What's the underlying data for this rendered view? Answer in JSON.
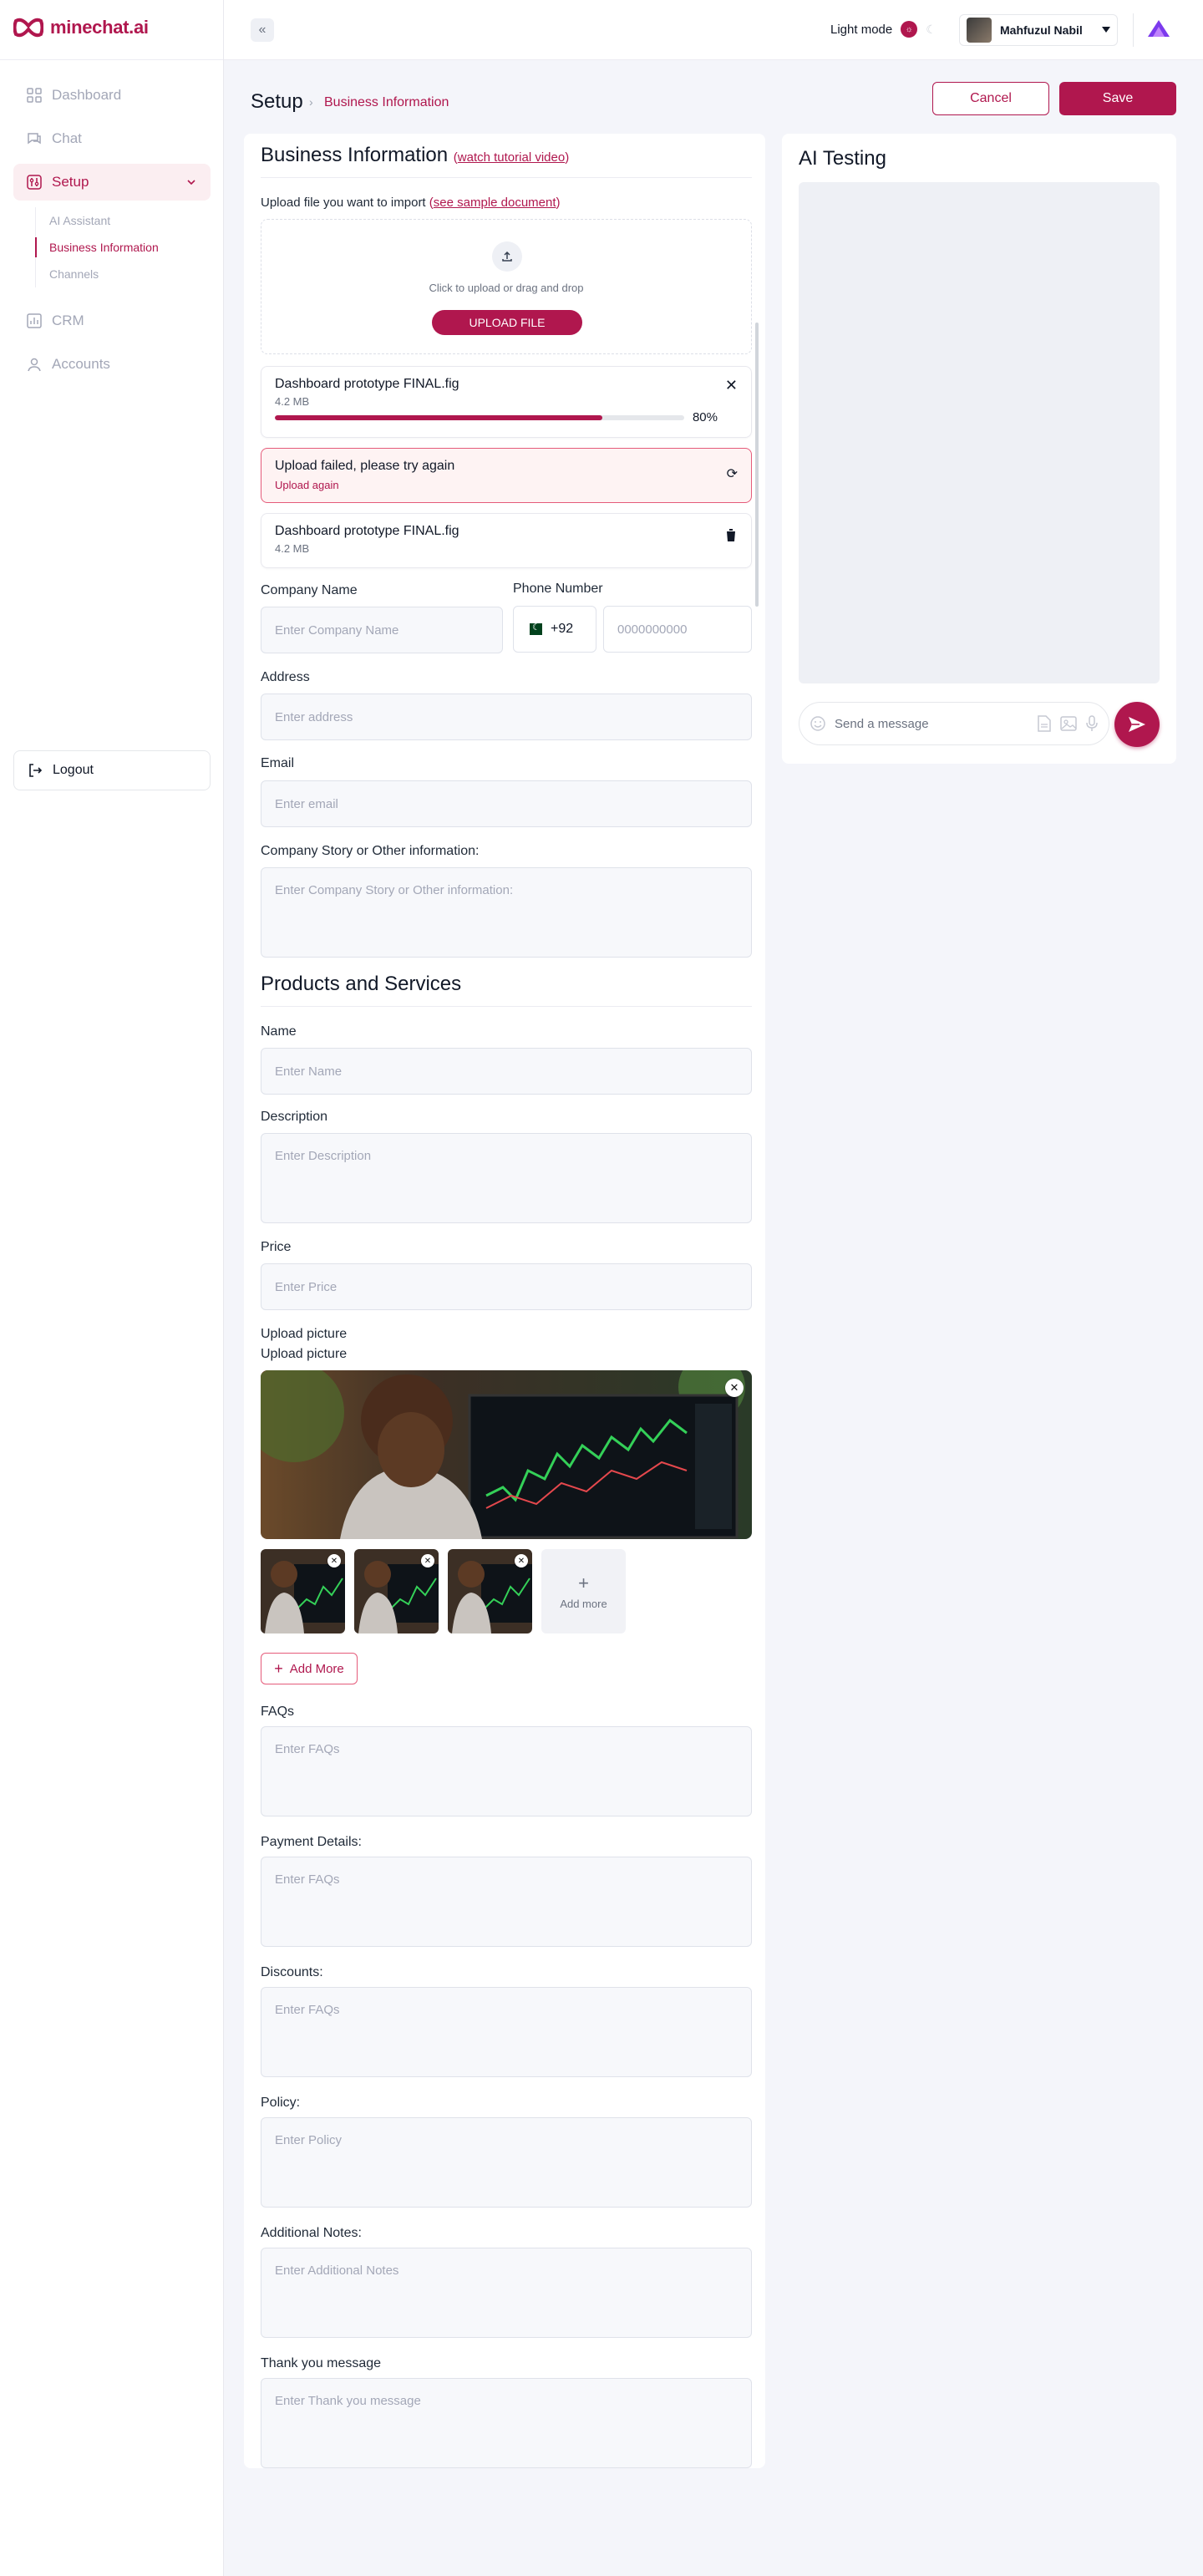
{
  "app": {
    "brand": "minechat.ai"
  },
  "sidebar": {
    "items": [
      {
        "label": "Dashboard",
        "icon": "dashboard-icon"
      },
      {
        "label": "Chat",
        "icon": "chat-icon"
      },
      {
        "label": "Setup",
        "icon": "setup-icon",
        "active": true
      },
      {
        "label": "CRM",
        "icon": "chart-icon"
      },
      {
        "label": "Accounts",
        "icon": "user-icon"
      }
    ],
    "setup_sub": [
      "AI Assistant",
      "Business Information",
      "Channels"
    ],
    "logout": "Logout"
  },
  "topbar": {
    "theme_label": "Light mode",
    "user_name": "Mahfuzul Nabil"
  },
  "header": {
    "title": "Setup",
    "breadcrumb": "Business Information",
    "cancel": "Cancel",
    "save": "Save"
  },
  "business": {
    "title": "Business Information",
    "tutorial_link": "watch tutorial video",
    "upload_prompt": "Upload file you want to import",
    "sample_link": "see sample document",
    "dropzone_text": "Click to upload or drag and drop",
    "upload_button": "UPLOAD FILE",
    "progress_file": {
      "name": "Dashboard prototype FINAL.fig",
      "size": "4.2 MB",
      "percent_label": "80%",
      "progress": 0.8
    },
    "failed": {
      "title": "Upload failed, please try again",
      "subtitle": "Upload again"
    },
    "done_file": {
      "name": "Dashboard prototype FINAL.fig",
      "size": "4.2 MB"
    },
    "company_name_label": "Company Name",
    "company_name_placeholder": "Enter  Company Name",
    "phone_label": "Phone Number",
    "phone_code": "+92",
    "phone_placeholder": "0000000000",
    "address_label": "Address",
    "address_placeholder": "Enter address",
    "email_label": "Email",
    "email_placeholder": "Enter email",
    "story_label": "Company Story or Other information:",
    "story_placeholder": "Enter Company Story or Other information:"
  },
  "products": {
    "title": "Products and Services",
    "name_label": "Name",
    "name_placeholder": "Enter Name",
    "desc_label": "Description",
    "desc_placeholder": "Enter Description",
    "price_label": "Price",
    "price_placeholder": "Enter Price",
    "upload_label_1": "Upload picture",
    "upload_label_2": "Upload picture",
    "add_more_tile": "Add more",
    "add_more_button": "Add More",
    "faqs_label": "FAQs",
    "faqs_placeholder": "Enter FAQs",
    "payment_label": "Payment Details:",
    "payment_placeholder": "Enter FAQs",
    "discounts_label": "Discounts:",
    "discounts_placeholder": "Enter FAQs",
    "policy_label": "Policy:",
    "policy_placeholder": "Enter Policy",
    "notes_label": "Additional Notes:",
    "notes_placeholder": "Enter Additional Notes",
    "thanks_label": "Thank you message",
    "thanks_placeholder": "Enter Thank you message"
  },
  "ai_testing": {
    "title": "AI Testing",
    "message_placeholder": "Send a message"
  },
  "colors": {
    "accent": "#b0174e",
    "background": "#f4f5fa",
    "error_border": "#e55b7a"
  }
}
